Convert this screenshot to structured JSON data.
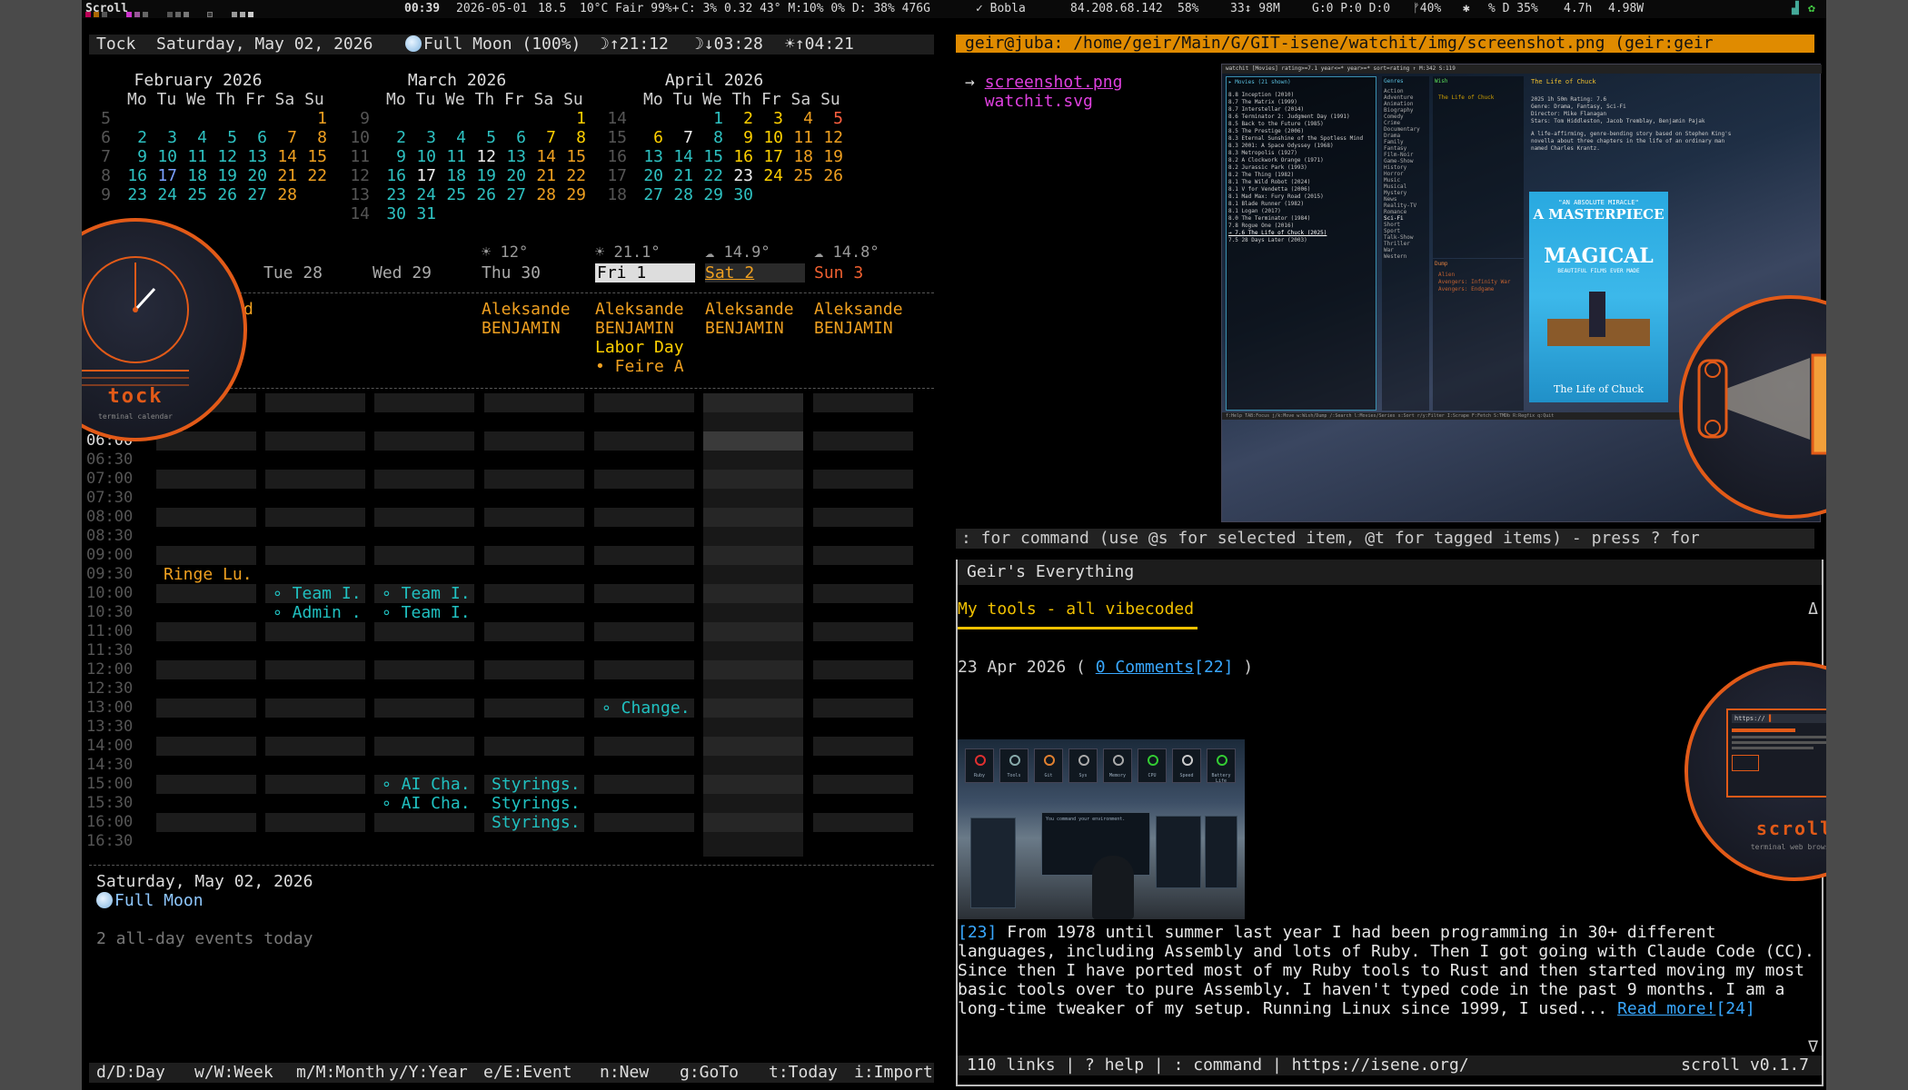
{
  "statusbar": {
    "wm": "Scroll",
    "time": "00:39",
    "date": "2026-05-01",
    "temp_val": "18.5",
    "weather": "10°C Fair 99%+",
    "cpu": "C:  3% 0.32 43° M:10%  0%  D: 38% 476G",
    "user": "✓ Bobla",
    "ip": "84.208.68.142",
    "battery": "58%",
    "net": "33↕ 98M",
    "misc": "G:0 P:0 D:0",
    "bright": "ᚠ40%",
    "misc2": "✱",
    "vol": "% D 35%",
    "rate": "4.7h",
    "power": "4.98W"
  },
  "tock": {
    "app": "Tock",
    "today": "Saturday, May 02, 2026",
    "moon": "Full Moon (100%)",
    "moonset": "☽↑21:12",
    "moonrise": "☽↓03:28",
    "sunrise": "☀↑04:21"
  },
  "months": [
    {
      "title": "February 2026",
      "hdr": "Mo Tu We Th Fr Sa Su",
      "weeks": [
        [
          "5",
          "",
          "",
          "",
          "",
          "",
          "",
          "1"
        ],
        [
          "6",
          "2",
          "3",
          "4",
          "5",
          "6",
          "7",
          "8"
        ],
        [
          "7",
          "9",
          "10",
          "11",
          "12",
          "13",
          "14",
          "15"
        ],
        [
          "8",
          "16",
          "17",
          "18",
          "19",
          "20",
          "21",
          "22"
        ],
        [
          "9",
          "23",
          "24",
          "25",
          "26",
          "27",
          "28",
          ""
        ]
      ]
    },
    {
      "title": "March 2026",
      "hdr": "Mo Tu We Th Fr Sa Su",
      "weeks": [
        [
          "9",
          "",
          "",
          "",
          "",
          "",
          "",
          "1"
        ],
        [
          "10",
          "2",
          "3",
          "4",
          "5",
          "6",
          "7",
          "8"
        ],
        [
          "11",
          "9",
          "10",
          "11",
          "12",
          "13",
          "14",
          "15"
        ],
        [
          "12",
          "16",
          "17",
          "18",
          "19",
          "20",
          "21",
          "22"
        ],
        [
          "13",
          "23",
          "24",
          "25",
          "26",
          "27",
          "28",
          "29"
        ],
        [
          "14",
          "30",
          "31",
          "",
          "",
          "",
          "",
          ""
        ]
      ]
    },
    {
      "title": "April 2026",
      "hdr": "Mo Tu We Th Fr Sa Su",
      "weeks": [
        [
          "14",
          "",
          "",
          "1",
          "2",
          "3",
          "4",
          "5"
        ],
        [
          "15",
          "6",
          "7",
          "8",
          "9",
          "10",
          "11",
          "12"
        ],
        [
          "16",
          "13",
          "14",
          "15",
          "16",
          "17",
          "18",
          "19"
        ],
        [
          "17",
          "20",
          "21",
          "22",
          "23",
          "24",
          "25",
          "26"
        ],
        [
          "18",
          "27",
          "28",
          "29",
          "30",
          "",
          "",
          ""
        ]
      ]
    }
  ],
  "week": {
    "days": [
      "Tue 28",
      "Wed 29",
      "Thu 30",
      "Fri 1",
      "Sat 2",
      "Sun 3"
    ],
    "temps": [
      "",
      "",
      "☀ 12°",
      "☀ 21.1°",
      "☁ 14.9°",
      "☁ 14.8°"
    ],
    "allday_prefix": "d",
    "allday": [
      [],
      [],
      [
        "Aleksande",
        "BENJAMIN"
      ],
      [
        "Aleksande",
        "BENJAMIN",
        "Labor Day",
        "• Feire A"
      ],
      [
        "Aleksande",
        "BENJAMIN"
      ],
      [
        "Aleksande",
        "BENJAMIN"
      ]
    ]
  },
  "times": [
    "06:00",
    "06:30",
    "07:00",
    "07:30",
    "08:00",
    "08:30",
    "09:00",
    "09:30",
    "10:00",
    "10:30",
    "11:00",
    "11:30",
    "12:00",
    "12:30",
    "13:00",
    "13:30",
    "14:00",
    "14:30",
    "15:00",
    "15:30",
    "16:00",
    "16:30"
  ],
  "events": {
    "ringe": "Ringe Lu.",
    "tue_1000": "∘ Team I.",
    "tue_1030": "∘ Admin .",
    "wed_1000": "∘ Team I.",
    "wed_1030": "∘ Team I.",
    "fri_1300": "∘ Change.",
    "wed_1500": "∘ AI Cha.",
    "wed_1530": "∘ AI Cha.",
    "thu_1500": "Styrings.",
    "thu_1530": "Styrings.",
    "thu_1600": "Styrings."
  },
  "selected": {
    "date": "Saturday, May 02, 2026",
    "moon": "Full Moon",
    "allday": "2 all-day events today"
  },
  "keys": [
    "d/D:Day",
    "w/W:Week",
    "m/M:Month",
    "y/Y:Year",
    "e/E:Event",
    "n:New",
    "g:GoTo",
    "t:Today",
    "i:Import"
  ],
  "badges": {
    "tock": "tock",
    "tock_sub": "terminal calendar",
    "scroll": "scroll",
    "scroll_sub": "terminal web browser"
  },
  "rtop": {
    "title": "geir@juba: /home/geir/Main/G/GIT-isene/watchit/img/screenshot.png (geir:geir",
    "files": [
      "screenshot.png",
      "watchit.svg"
    ],
    "cmd": ": for command (use @s for selected item, @t for tagged items) - press ? for"
  },
  "watchit": {
    "topbar": "watchit  [Movies]  rating>=7.1  year<=*  year>=*  sort=rating  ↑ M:342  S:119",
    "list_title": "▸ Movies (21 shown)",
    "movies": [
      "8.8  Inception (2010)",
      "8.7  The Matrix (1999)",
      "8.7  Interstellar (2014)",
      "8.6  Terminator 2: Judgment Day (1991)",
      "8.5  Back to the Future (1985)",
      "8.5  The Prestige (2006)",
      "8.3  Eternal Sunshine of the Spotless Mind",
      "8.3  2001: A Space Odyssey (1968)",
      "8.3  Metropolis (1927)",
      "8.2  A Clockwork Orange (1971)",
      "8.2  Jurassic Park (1993)",
      "8.2  The Thing (1982)",
      "8.1  The Wild Robot (2024)",
      "8.1  V for Vendetta (2006)",
      "8.1  Mad Max: Fury Road (2015)",
      "8.1  Blade Runner (1982)",
      "8.1  Logan (2017)",
      "8.0  The Terminator (1984)",
      "7.8  Rogue One (2016)",
      "→ 7.6  The Life of Chuck (2025)",
      "7.5  28 Days Later (2003)"
    ],
    "genres_title": "Genres",
    "genres": [
      "Action",
      "Adventure",
      "Animation",
      "Biography",
      "Comedy",
      "Crime",
      "Documentary",
      "Drama",
      "Family",
      "Fantasy",
      "Film-Noir",
      "Game-Show",
      "History",
      "Horror",
      "Music",
      "Musical",
      "Mystery",
      "News",
      "Reality-TV",
      "Romance",
      "Sci-Fi",
      "Short",
      "Sport",
      "Talk-Show",
      "Thriller",
      "War",
      "Western"
    ],
    "wish_title": "Wish",
    "wish": [
      "The Life of Chuck"
    ],
    "dump_title": "Dump",
    "dump": [
      "Alien",
      "Avengers: Infinity War",
      "Avengers: Endgame"
    ],
    "detail_title": "The Life of Chuck",
    "detail": [
      "2025  1h 50m  Rating: 7.6",
      "Genre: Drama, Fantasy, Sci-Fi",
      "Director: Mike Flanagan",
      "Stars: Tom Hiddleston, Jacob Tremblay, Benjamin Pajak"
    ],
    "desc": "A life-affirming, genre-bending story based on Stephen King's novella about three chapters in the life of an ordinary man named Charles Krantz.",
    "poster": {
      "tag": "\"AN ABSOLUTE MIRACLE\"",
      "big1": "A MASTERPIECE",
      "big2": "MAGICAL",
      "line": "BEAUTIFUL FILMS EVER MADE",
      "title": "The Life of Chuck"
    },
    "footer": "f:Help  TAB:Focus  j/k:Move  w:Wish/Dump  /:Search  l:Movies/Series  s:Sort  r/y:Filter  I:Scrape  F:Fetch  S:TMDb  R:Regfix  q:Quit"
  },
  "scroll": {
    "title": "Geir's Everything",
    "heading": "My tools - all vibecoded",
    "date_pre": "23 Apr 2026 (",
    "comments": "0 Comments",
    "comments_ref": "[22]",
    "date_post": ")",
    "ref23": "[23]",
    "body": "From 1978 until summer last year I had been programming in 30+ different languages, including Assembly and lots of Ruby. Then I got going with Claude Code (CC). Since then I have ported most of my Ruby tools to Rust and then started moving my most basic tools over to pure Assembly. I haven't typed code in the past 9 months. I am a long-time tweaker of my setup. Running Linux since 1999, I used...",
    "readmore": "Read more!",
    "readmore_ref": "[24]",
    "status": "110 links | ? help | : command | https://isene.org/",
    "version": "scroll v0.1.7",
    "up": "Δ",
    "down": "∇",
    "img_labels": [
      "Ruby",
      "Tools",
      "Git",
      "Sys",
      "Memory",
      "CPU",
      "Speed",
      "Battery Life"
    ],
    "img_prompt": "You command your environment."
  }
}
